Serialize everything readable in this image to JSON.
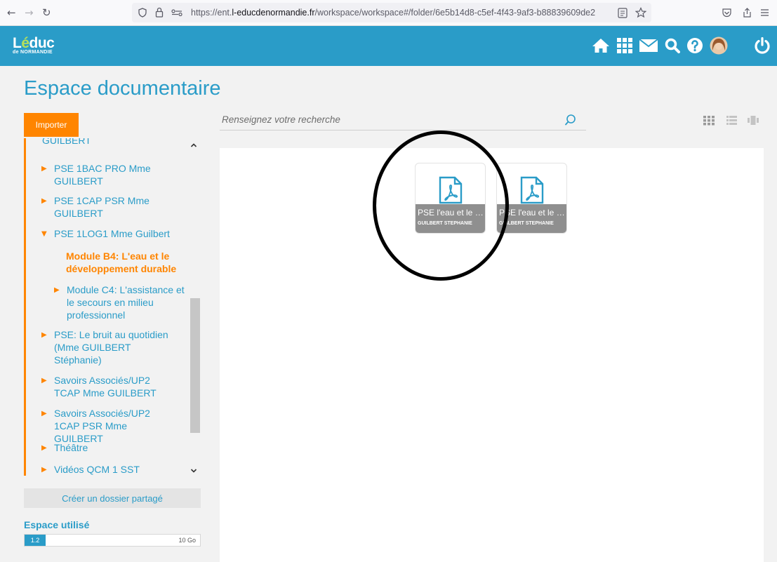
{
  "browser": {
    "url_prefix": "https://ent.",
    "url_domain": "l-educdenormandie.fr",
    "url_path": "/workspace/workspace#/folder/6e5b14d8-c5ef-4f43-9af3-b88839609de2",
    "back_icon": "←",
    "forward_icon": "→",
    "reload_icon": "↻"
  },
  "header": {
    "logo_main_prefix": "L",
    "logo_main_e": "é",
    "logo_main_suffix": "duc",
    "logo_sub": "de NORMANDIE",
    "icons": [
      "home-icon",
      "apps-grid-icon",
      "mail-icon",
      "search-icon",
      "help-icon",
      "avatar",
      "power-icon"
    ]
  },
  "page": {
    "title": "Espace documentaire",
    "import_label": "Importer",
    "search_placeholder": "Renseignez votre recherche",
    "shared_folder_label": "Créer un dossier partagé",
    "space_used_label": "Espace utilisé",
    "space_used_value": "1.2",
    "space_total": "10 Go",
    "space_fraction": 0.12
  },
  "tree": [
    {
      "label": "GUILBERT",
      "arrow": ""
    },
    {
      "label": "PSE 1BAC PRO Mme GUILBERT",
      "arrow": "▶"
    },
    {
      "label": "PSE 1CAP PSR Mme GUILBERT",
      "arrow": "▶"
    },
    {
      "label": "PSE 1LOG1 Mme Guilbert",
      "arrow": "▼"
    },
    {
      "label": "Module B4: L'eau et le développement durable",
      "arrow": ""
    },
    {
      "label": "Module C4: L'assistance et le secours en milieu professionnel",
      "arrow": "▶"
    },
    {
      "label": "PSE: Le bruit au quotidien (Mme GUILBERT Stéphanie)",
      "arrow": "▶"
    },
    {
      "label": "Savoirs Associés/UP2 TCAP Mme GUILBERT",
      "arrow": "▶"
    },
    {
      "label": "Savoirs Associés/UP2 1CAP PSR Mme GUILBERT",
      "arrow": "▶"
    },
    {
      "label": "Théâtre",
      "arrow": "▶"
    },
    {
      "label": "Vidéos QCM 1 SST",
      "arrow": "▶"
    }
  ],
  "files": [
    {
      "name": "PSE l'eau et le développement durable",
      "owner": "GUILBERT STEPHANIE"
    },
    {
      "name": "PSE l'eau et le développement durable",
      "owner": "GUILBERT STEPHANIE"
    }
  ],
  "colors": {
    "brand": "#2a9cc8",
    "accent": "#ff8500"
  }
}
